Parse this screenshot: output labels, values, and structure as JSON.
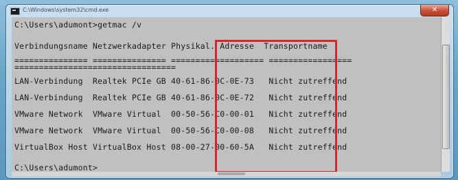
{
  "window": {
    "title": "C:\\Windows\\system32\\cmd.exe",
    "close_label": "✕"
  },
  "console": {
    "lines": [
      "C:\\Users\\adumont>getmac /v",
      "Verbindungsname Netzwerkadapter Physikal. Adresse  Transportname",
      "=============== =============== =================== =================",
      "=================================",
      "LAN-Verbindung  Realtek PCIe GB 40-61-86-0C-0E-73   Nicht zutreffend",
      "LAN-Verbindung  Realtek PCIe GB 40-61-86-0C-0E-72   Nicht zutreffend",
      "VMware Network  VMware Virtual  00-50-56-C0-00-01   Nicht zutreffend",
      "VMware Network  VMware Virtual  00-50-56-C0-00-08   Nicht zutreffend",
      "VirtualBox Host VirtualBox Host 08-00-27-00-60-5A   Nicht zutreffend",
      "",
      "C:\\Users\\adumont>"
    ]
  },
  "colors": {
    "highlight": "#d2262b",
    "console_bg": "#c0c0c0",
    "text": "#1a1a1a"
  }
}
